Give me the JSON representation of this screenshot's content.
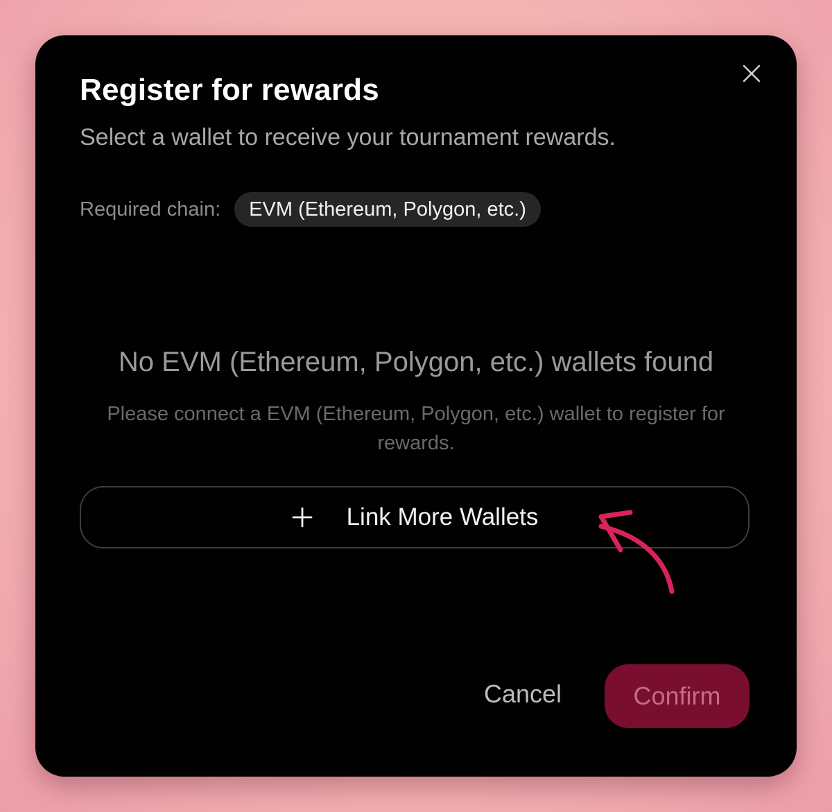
{
  "dialog": {
    "title": "Register for rewards",
    "subtitle": "Select a wallet to receive your tournament rewards.",
    "required_chain_label": "Required chain:",
    "required_chain_value": "EVM (Ethereum, Polygon, etc.)",
    "close_icon": "close-icon"
  },
  "empty_state": {
    "title": "No EVM (Ethereum, Polygon, etc.) wallets found",
    "message": "Please connect a EVM (Ethereum, Polygon, etc.) wallet to register for rewards."
  },
  "link_wallets": {
    "icon": "plus-icon",
    "label": "Link More Wallets"
  },
  "annotation": {
    "icon": "curved-arrow-annotation",
    "color": "#d8245a"
  },
  "footer": {
    "cancel_label": "Cancel",
    "confirm_label": "Confirm",
    "confirm_color": "#7a0e2f"
  }
}
